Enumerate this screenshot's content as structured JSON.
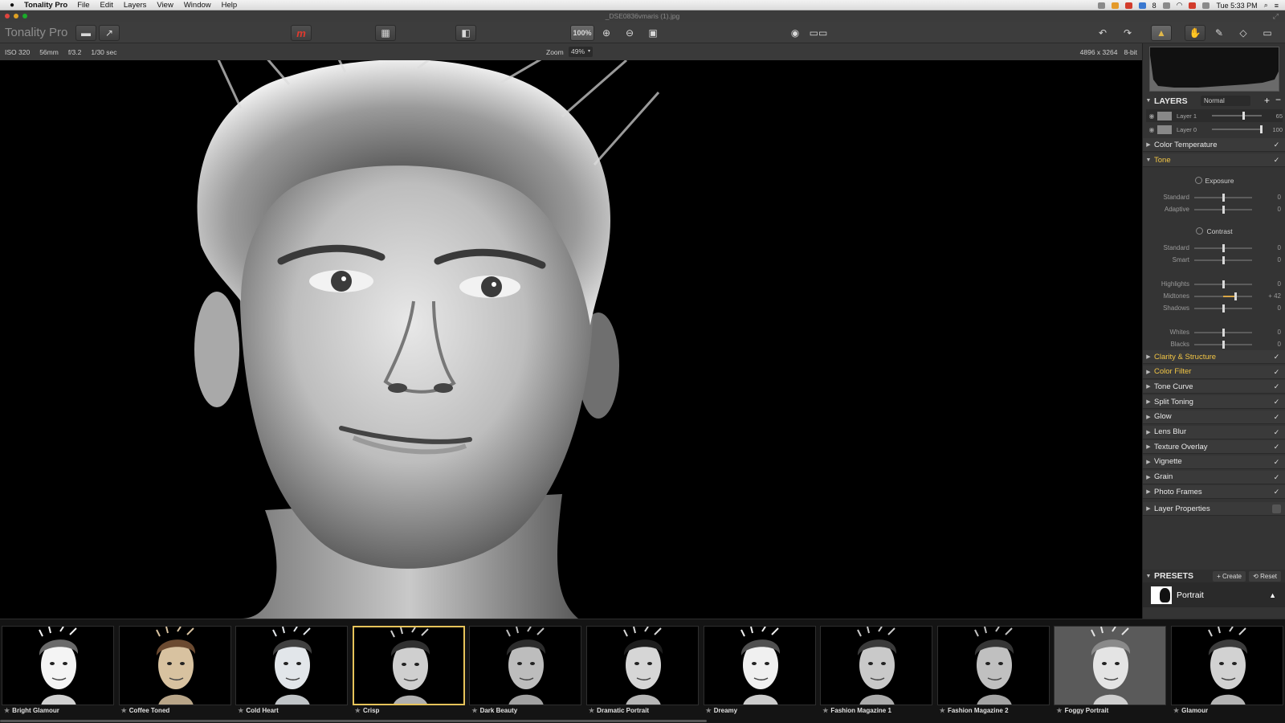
{
  "menubar": {
    "app_name": "Tonality Pro",
    "menus": [
      "File",
      "Edit",
      "Layers",
      "View",
      "Window",
      "Help"
    ],
    "tray_badge": "8",
    "clock": "Tue 5:33 PM"
  },
  "window": {
    "document_title": "_DSE0836vmaris (1).jpg"
  },
  "toolbar": {
    "brand": "Tonality Pro",
    "zoom_100_label": "100%",
    "accent_color": "#e03a2e"
  },
  "infobar": {
    "iso": "ISO 320",
    "focal": "56mm",
    "aperture": "f/3.2",
    "shutter": "1/30 sec",
    "zoom_label": "Zoom",
    "zoom_value": "49%",
    "dimensions": "4896 x 3264",
    "bit_depth": "8-bit"
  },
  "layers": {
    "title": "LAYERS",
    "blend_mode": "Normal",
    "items": [
      {
        "name": "Layer 1",
        "opacity": "65",
        "opacity_fraction": 0.65
      },
      {
        "name": "Layer 0",
        "opacity": "100",
        "opacity_fraction": 1.0
      }
    ]
  },
  "panels": {
    "color_temperature": "Color Temperature",
    "tone": "Tone",
    "exposure_title": "Exposure",
    "contrast_title": "Contrast",
    "tone_sliders": [
      {
        "label": "Standard",
        "value": "0",
        "level": 0.5
      },
      {
        "label": "Adaptive",
        "value": "0",
        "level": 0.5
      },
      {
        "label": "Standard",
        "value": "0",
        "level": 0.5
      },
      {
        "label": "Smart",
        "value": "0",
        "level": 0.5
      },
      {
        "label": "Highlights",
        "value": "0",
        "level": 0.5
      },
      {
        "label": "Midtones",
        "value": "+ 42",
        "level": 0.71
      },
      {
        "label": "Shadows",
        "value": "0",
        "level": 0.5
      },
      {
        "label": "Whites",
        "value": "0",
        "level": 0.5
      },
      {
        "label": "Blacks",
        "value": "0",
        "level": 0.5
      }
    ],
    "collapsed": [
      {
        "label": "Clarity & Structure",
        "highlight": true
      },
      {
        "label": "Color Filter",
        "highlight": true
      },
      {
        "label": "Tone Curve",
        "highlight": false
      },
      {
        "label": "Split Toning",
        "highlight": false
      },
      {
        "label": "Glow",
        "highlight": false
      },
      {
        "label": "Lens Blur",
        "highlight": false
      },
      {
        "label": "Texture Overlay",
        "highlight": false
      },
      {
        "label": "Vignette",
        "highlight": false
      },
      {
        "label": "Grain",
        "highlight": false
      },
      {
        "label": "Photo Frames",
        "highlight": false
      },
      {
        "label": "Layer Properties",
        "highlight": false
      }
    ],
    "highlight_color": "#f2c545"
  },
  "presets": {
    "title": "PRESETS",
    "create": "Create",
    "reset": "Reset",
    "category": "Portrait",
    "items": [
      "Bright Glamour",
      "Coffee Toned",
      "Cold Heart",
      "Crisp",
      "Dark Beauty",
      "Dramatic Portrait",
      "Dreamy",
      "Fashion Magazine 1",
      "Fashion Magazine 2",
      "Foggy Portrait",
      "Glamour"
    ],
    "selected": "Crisp",
    "selected_border_color": "#e6c35a"
  }
}
